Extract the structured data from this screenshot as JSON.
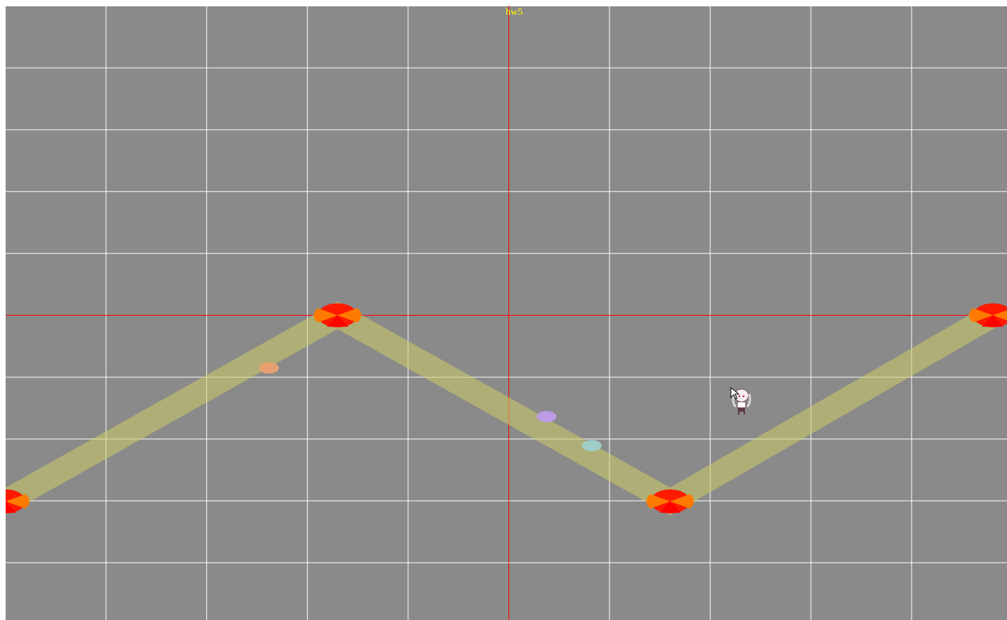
{
  "title": "hw5",
  "colors": {
    "background": "#8a8a8a",
    "grid": "#ffffff",
    "axis": "#ff0000",
    "path": "#cccc66",
    "waypoint_primary": "#ff1a00",
    "waypoint_secondary": "#ff7a00",
    "title_text": "#ffff00"
  },
  "scene": {
    "waypoints": [
      "waypoint-1",
      "waypoint-2",
      "waypoint-3",
      "waypoint-4"
    ],
    "orbs": [
      {
        "name": "orb-orange",
        "color": "#f0a070"
      },
      {
        "name": "orb-purple",
        "color": "#c09cf0"
      },
      {
        "name": "orb-teal",
        "color": "#a0d0d0"
      }
    ],
    "sprite": "player-character-sprite",
    "cursor": "mouse-cursor-icon"
  }
}
